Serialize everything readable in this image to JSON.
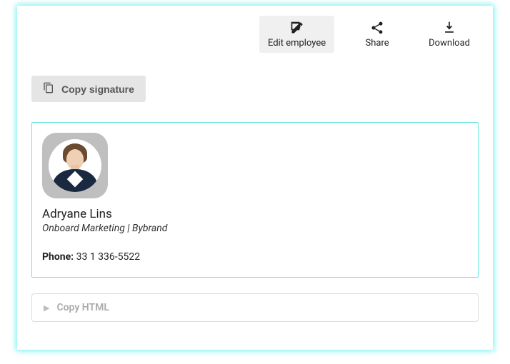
{
  "toolbar": {
    "edit": {
      "label": "Edit employee"
    },
    "share": {
      "label": "Share"
    },
    "download": {
      "label": "Download"
    }
  },
  "actions": {
    "copy_signature": "Copy signature",
    "copy_html": "Copy HTML"
  },
  "signature": {
    "name": "Adryane Lins",
    "title": "Onboard Marketing | Bybrand",
    "phone_label": "Phone:",
    "phone_value": "33 1 336-5522"
  }
}
